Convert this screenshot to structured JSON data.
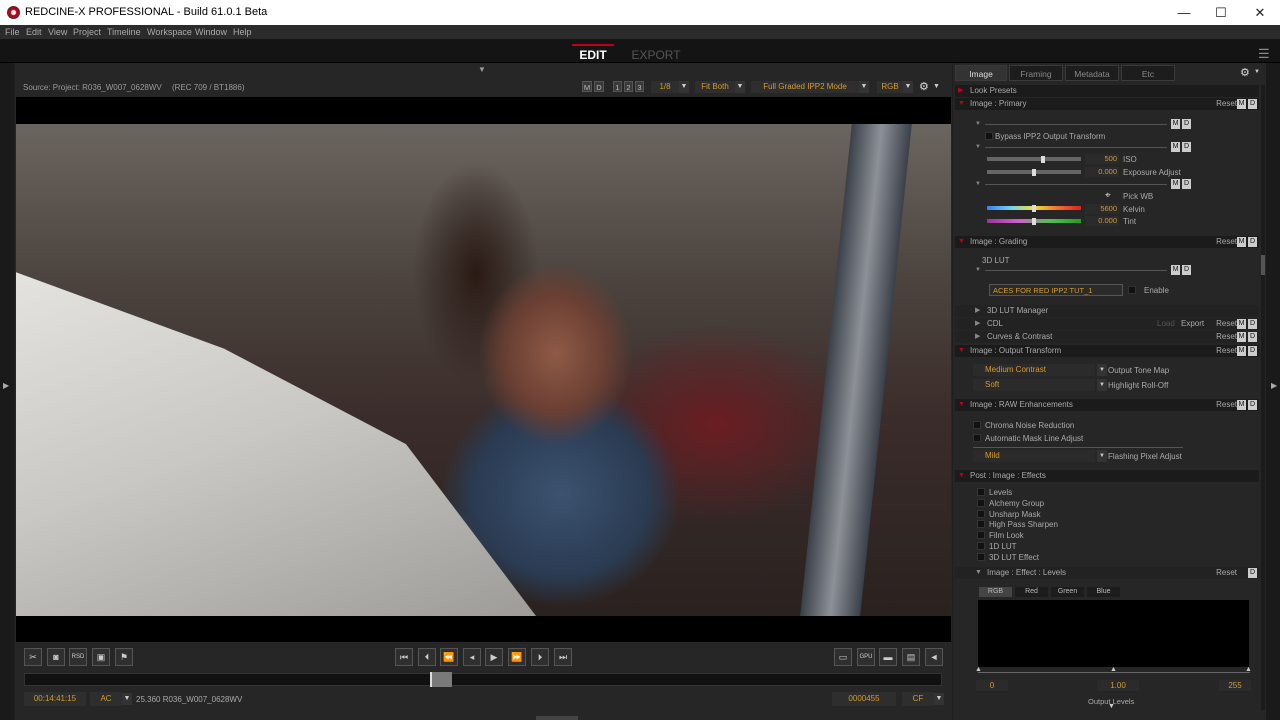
{
  "window": {
    "title": "REDCINE-X PROFESSIONAL - Build 61.0.1 Beta",
    "min": "—",
    "max": "☐",
    "close": "✕"
  },
  "menu": [
    "File",
    "Edit",
    "View",
    "Project",
    "Timeline",
    "Workspace",
    "Window",
    "Help"
  ],
  "modes": {
    "edit": "EDIT",
    "export": "EXPORT"
  },
  "viewer": {
    "source": "Source: Project: R036_W007_0628WV",
    "colorspace": "(REC 709 / BT1886)",
    "m": "M",
    "d": "D",
    "n1": "1",
    "n2": "2",
    "n3": "3",
    "scale": "1/8",
    "fit": "Fit Both",
    "mode": "Full Graded IPP2 Mode",
    "channel": "RGB"
  },
  "transport_labels": {
    "gpu": "GPU",
    "rsd": "RSD"
  },
  "status": {
    "timecode": "00:14:41:15",
    "tc_mode": "AC",
    "clip": "25.360 R036_W007_0628WV",
    "frame": "0000455",
    "cf": "CF"
  },
  "panel": {
    "tabs": [
      "Image",
      "Framing",
      "Metadata",
      "Etc"
    ],
    "look_presets": "Look Presets",
    "primary": {
      "title": "Image : Primary",
      "reset": "Reset",
      "bypass": "Bypass IPP2 Output Transform",
      "iso": "500",
      "iso_label": "ISO",
      "exposure": "0.000",
      "exposure_label": "Exposure Adjust",
      "pick_wb": "Pick WB",
      "kelvin": "5600",
      "kelvin_label": "Kelvin",
      "tint": "0.000",
      "tint_label": "Tint",
      "iso_level": 0.6,
      "exposure_level": 0.5,
      "kelvin_level": 0.5,
      "tint_level": 0.5
    },
    "grading": {
      "title": "Image : Grading",
      "reset": "Reset",
      "lut_label": "3D LUT",
      "lut_value": "ACES FOR RED IPP2 TUT_1",
      "enable": "Enable"
    },
    "collapsed": [
      {
        "label": "3D LUT Manager"
      },
      {
        "label": "CDL",
        "load": "Load",
        "export": "Export",
        "reset": "Reset"
      },
      {
        "label": "Curves & Contrast",
        "reset": "Reset"
      }
    ],
    "output": {
      "title": "Image : Output Transform",
      "reset": "Reset",
      "tonemap": "Medium Contrast",
      "tonemap_label": "Output Tone Map",
      "rolloff": "Soft",
      "rolloff_label": "Highlight Roll-Off"
    },
    "raw": {
      "title": "Image : RAW Enhancements",
      "reset": "Reset",
      "chroma": "Chroma Noise Reduction",
      "mask": "Automatic Mask Line Adjust",
      "flash": "Mild",
      "flash_label": "Flashing Pixel Adjust"
    },
    "effects": {
      "title": "Post : Image : Effects",
      "items": [
        "Levels",
        "Alchemy Group",
        "Unsharp Mask",
        "High Pass Sharpen",
        "Film Look",
        "1D LUT",
        "3D LUT Effect"
      ]
    },
    "levels": {
      "title": "Image : Effect : Levels",
      "reset": "Reset",
      "tabs": [
        "RGB",
        "Red",
        "Green",
        "Blue"
      ],
      "low": "0",
      "mid": "1.00",
      "high": "255",
      "output": "Output Levels"
    }
  }
}
